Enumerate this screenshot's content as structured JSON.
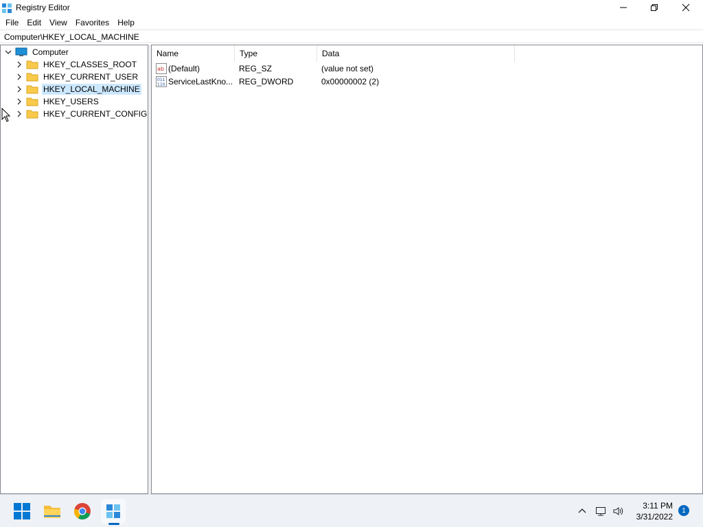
{
  "window": {
    "title": "Registry Editor",
    "icon": "regedit-icon"
  },
  "menu": [
    "File",
    "Edit",
    "View",
    "Favorites",
    "Help"
  ],
  "address": "Computer\\HKEY_LOCAL_MACHINE",
  "tree": {
    "root": {
      "label": "Computer",
      "expanded": true,
      "icon": "computer-icon"
    },
    "children": [
      {
        "label": "HKEY_CLASSES_ROOT",
        "selected": false
      },
      {
        "label": "HKEY_CURRENT_USER",
        "selected": false
      },
      {
        "label": "HKEY_LOCAL_MACHINE",
        "selected": true
      },
      {
        "label": "HKEY_USERS",
        "selected": false
      },
      {
        "label": "HKEY_CURRENT_CONFIG",
        "selected": false
      }
    ]
  },
  "list": {
    "columns": [
      "Name",
      "Type",
      "Data"
    ],
    "rows": [
      {
        "icon": "string-value-icon",
        "name": "(Default)",
        "type": "REG_SZ",
        "data": "(value not set)"
      },
      {
        "icon": "binary-value-icon",
        "name": "ServiceLastKno...",
        "type": "REG_DWORD",
        "data": "0x00000002 (2)"
      }
    ]
  },
  "taskbar": {
    "apps": [
      "start-icon",
      "file-explorer-icon",
      "chrome-icon",
      "regedit-icon"
    ],
    "time": "3:11 PM",
    "date": "3/31/2022",
    "notification_count": "1"
  },
  "colors": {
    "selection": "#cce8ff",
    "accent": "#0067c0",
    "folder": "#f8c94a"
  }
}
